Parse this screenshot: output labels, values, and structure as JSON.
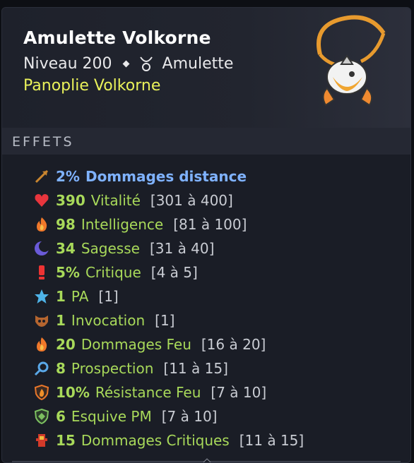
{
  "item": {
    "name": "Amulette Volkorne",
    "level": "Niveau 200",
    "type": "Amulette",
    "set": "Panoplie Volkorne"
  },
  "section_title": "EFFETS",
  "effects": [
    {
      "icon": "bow-arrow-icon",
      "value": "2%",
      "label": "Dommages distance",
      "range": "",
      "color": "blue"
    },
    {
      "icon": "heart-icon",
      "value": "390",
      "label": "Vitalité",
      "range": "[301 à 400]",
      "color": "green"
    },
    {
      "icon": "fire-icon",
      "value": "98",
      "label": "Intelligence",
      "range": "[81 à 100]",
      "color": "green"
    },
    {
      "icon": "moon-icon",
      "value": "34",
      "label": "Sagesse",
      "range": "[31 à 40]",
      "color": "green"
    },
    {
      "icon": "exclamation-icon",
      "value": "5%",
      "label": "Critique",
      "range": "[4 à 5]",
      "color": "green"
    },
    {
      "icon": "star-icon",
      "value": "1",
      "label": "PA",
      "range": "[1]",
      "color": "green"
    },
    {
      "icon": "creature-icon",
      "value": "1",
      "label": "Invocation",
      "range": "[1]",
      "color": "green"
    },
    {
      "icon": "fire-icon",
      "value": "20",
      "label": "Dommages Feu",
      "range": "[16 à 20]",
      "color": "green"
    },
    {
      "icon": "magnifier-icon",
      "value": "8",
      "label": "Prospection",
      "range": "[11 à 15]",
      "color": "green"
    },
    {
      "icon": "fire-shield-icon",
      "value": "10%",
      "label": "Résistance Feu",
      "range": "[7 à 10]",
      "color": "green"
    },
    {
      "icon": "green-shield-icon",
      "value": "6",
      "label": "Esquive PM",
      "range": "[7 à 10]",
      "color": "green"
    },
    {
      "icon": "critical-damage-icon",
      "value": "15",
      "label": "Dommages Critiques",
      "range": "[11 à 15]",
      "color": "green"
    }
  ]
}
